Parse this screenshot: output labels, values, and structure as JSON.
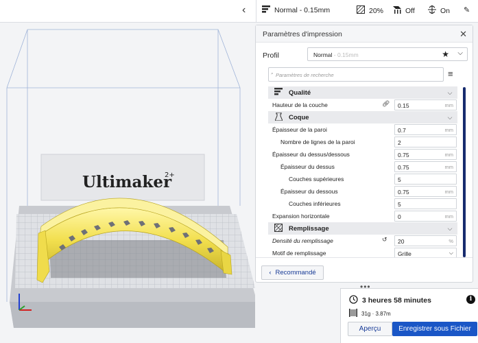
{
  "topbar": {
    "quality": "Normal - 0.15mm",
    "infill": "20%",
    "support": "Off",
    "adhesion": "On"
  },
  "model": {
    "brand_text": "Ultimaker",
    "brand_superscript": "2+"
  },
  "panel": {
    "title": "Paramètres d'impression",
    "profile_label": "Profil",
    "profile_name": "Normal",
    "profile_sub": " - 0.15mm",
    "search_placeholder": "Paramètres de recherche",
    "recommended_button": "Recommandé"
  },
  "settings": {
    "cat_quality": "Qualité",
    "layer_height": {
      "label": "Hauteur de la couche",
      "value": "0.15",
      "unit": "mm"
    },
    "cat_shell": "Coque",
    "wall_thickness": {
      "label": "Épaisseur de la paroi",
      "value": "0.7",
      "unit": "mm"
    },
    "wall_line_count": {
      "label": "Nombre de lignes de la paroi",
      "value": "2",
      "unit": ""
    },
    "top_bottom_thickness": {
      "label": "Épaisseur du dessus/dessous",
      "value": "0.75",
      "unit": "mm"
    },
    "top_thickness": {
      "label": "Épaisseur du dessus",
      "value": "0.75",
      "unit": "mm"
    },
    "top_layers": {
      "label": "Couches supérieures",
      "value": "5",
      "unit": ""
    },
    "bottom_thickness": {
      "label": "Épaisseur du dessous",
      "value": "0.75",
      "unit": "mm"
    },
    "bottom_layers": {
      "label": "Couches inférieures",
      "value": "5",
      "unit": ""
    },
    "horizontal_expansion": {
      "label": "Expansion horizontale",
      "value": "0",
      "unit": "mm"
    },
    "cat_infill": "Remplissage",
    "infill_density": {
      "label": "Densité du remplissage",
      "value": "20",
      "unit": "%"
    },
    "infill_pattern": {
      "label": "Motif de remplissage",
      "value": "Grille"
    }
  },
  "job": {
    "time": "3 heures 58 minutes",
    "material": "31g · 3.87m",
    "preview_button": "Aperçu",
    "save_button": "Enregistrer sous Fichier"
  },
  "colors": {
    "accent": "#1a56c6",
    "scrollbar": "#172b6e",
    "model": "#f4e36a",
    "build_plate": "#cfd1d6"
  },
  "icons": [
    "chevron-left-icon",
    "quality-icon",
    "infill-icon",
    "support-icon",
    "adhesion-icon",
    "edit-icon",
    "close-icon",
    "star-icon",
    "chevron-down-icon",
    "search-icon",
    "menu-icon",
    "link-icon",
    "reset-icon",
    "clock-icon",
    "spool-icon",
    "info-icon",
    "chevron-left-icon"
  ]
}
